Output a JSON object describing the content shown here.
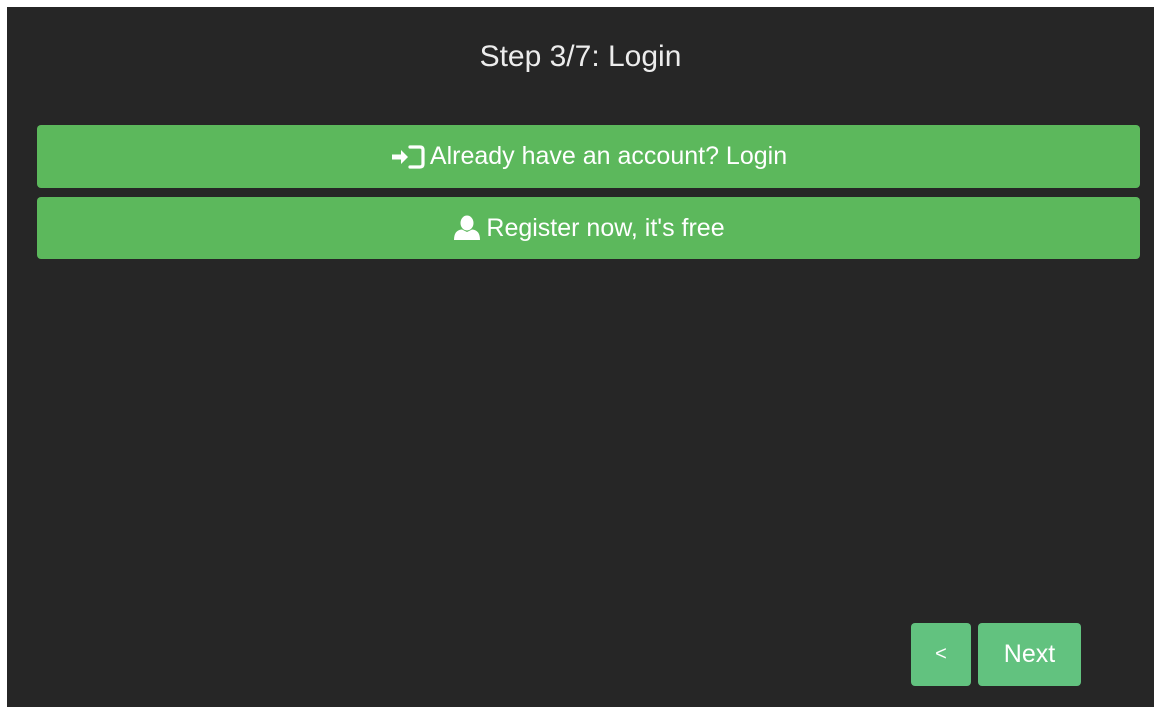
{
  "wizard": {
    "title": "Step 3/7: Login"
  },
  "actions": {
    "login_label": "Already have an account? Login",
    "register_label": "Register now, it's free"
  },
  "navigation": {
    "prev_label": "<",
    "next_label": "Next"
  },
  "icons": {
    "login": "sign-in-icon",
    "register": "user-icon"
  },
  "colors": {
    "background": "#262626",
    "primary": "#5cb85c",
    "nav": "#62c27f",
    "text": "#ffffff"
  }
}
